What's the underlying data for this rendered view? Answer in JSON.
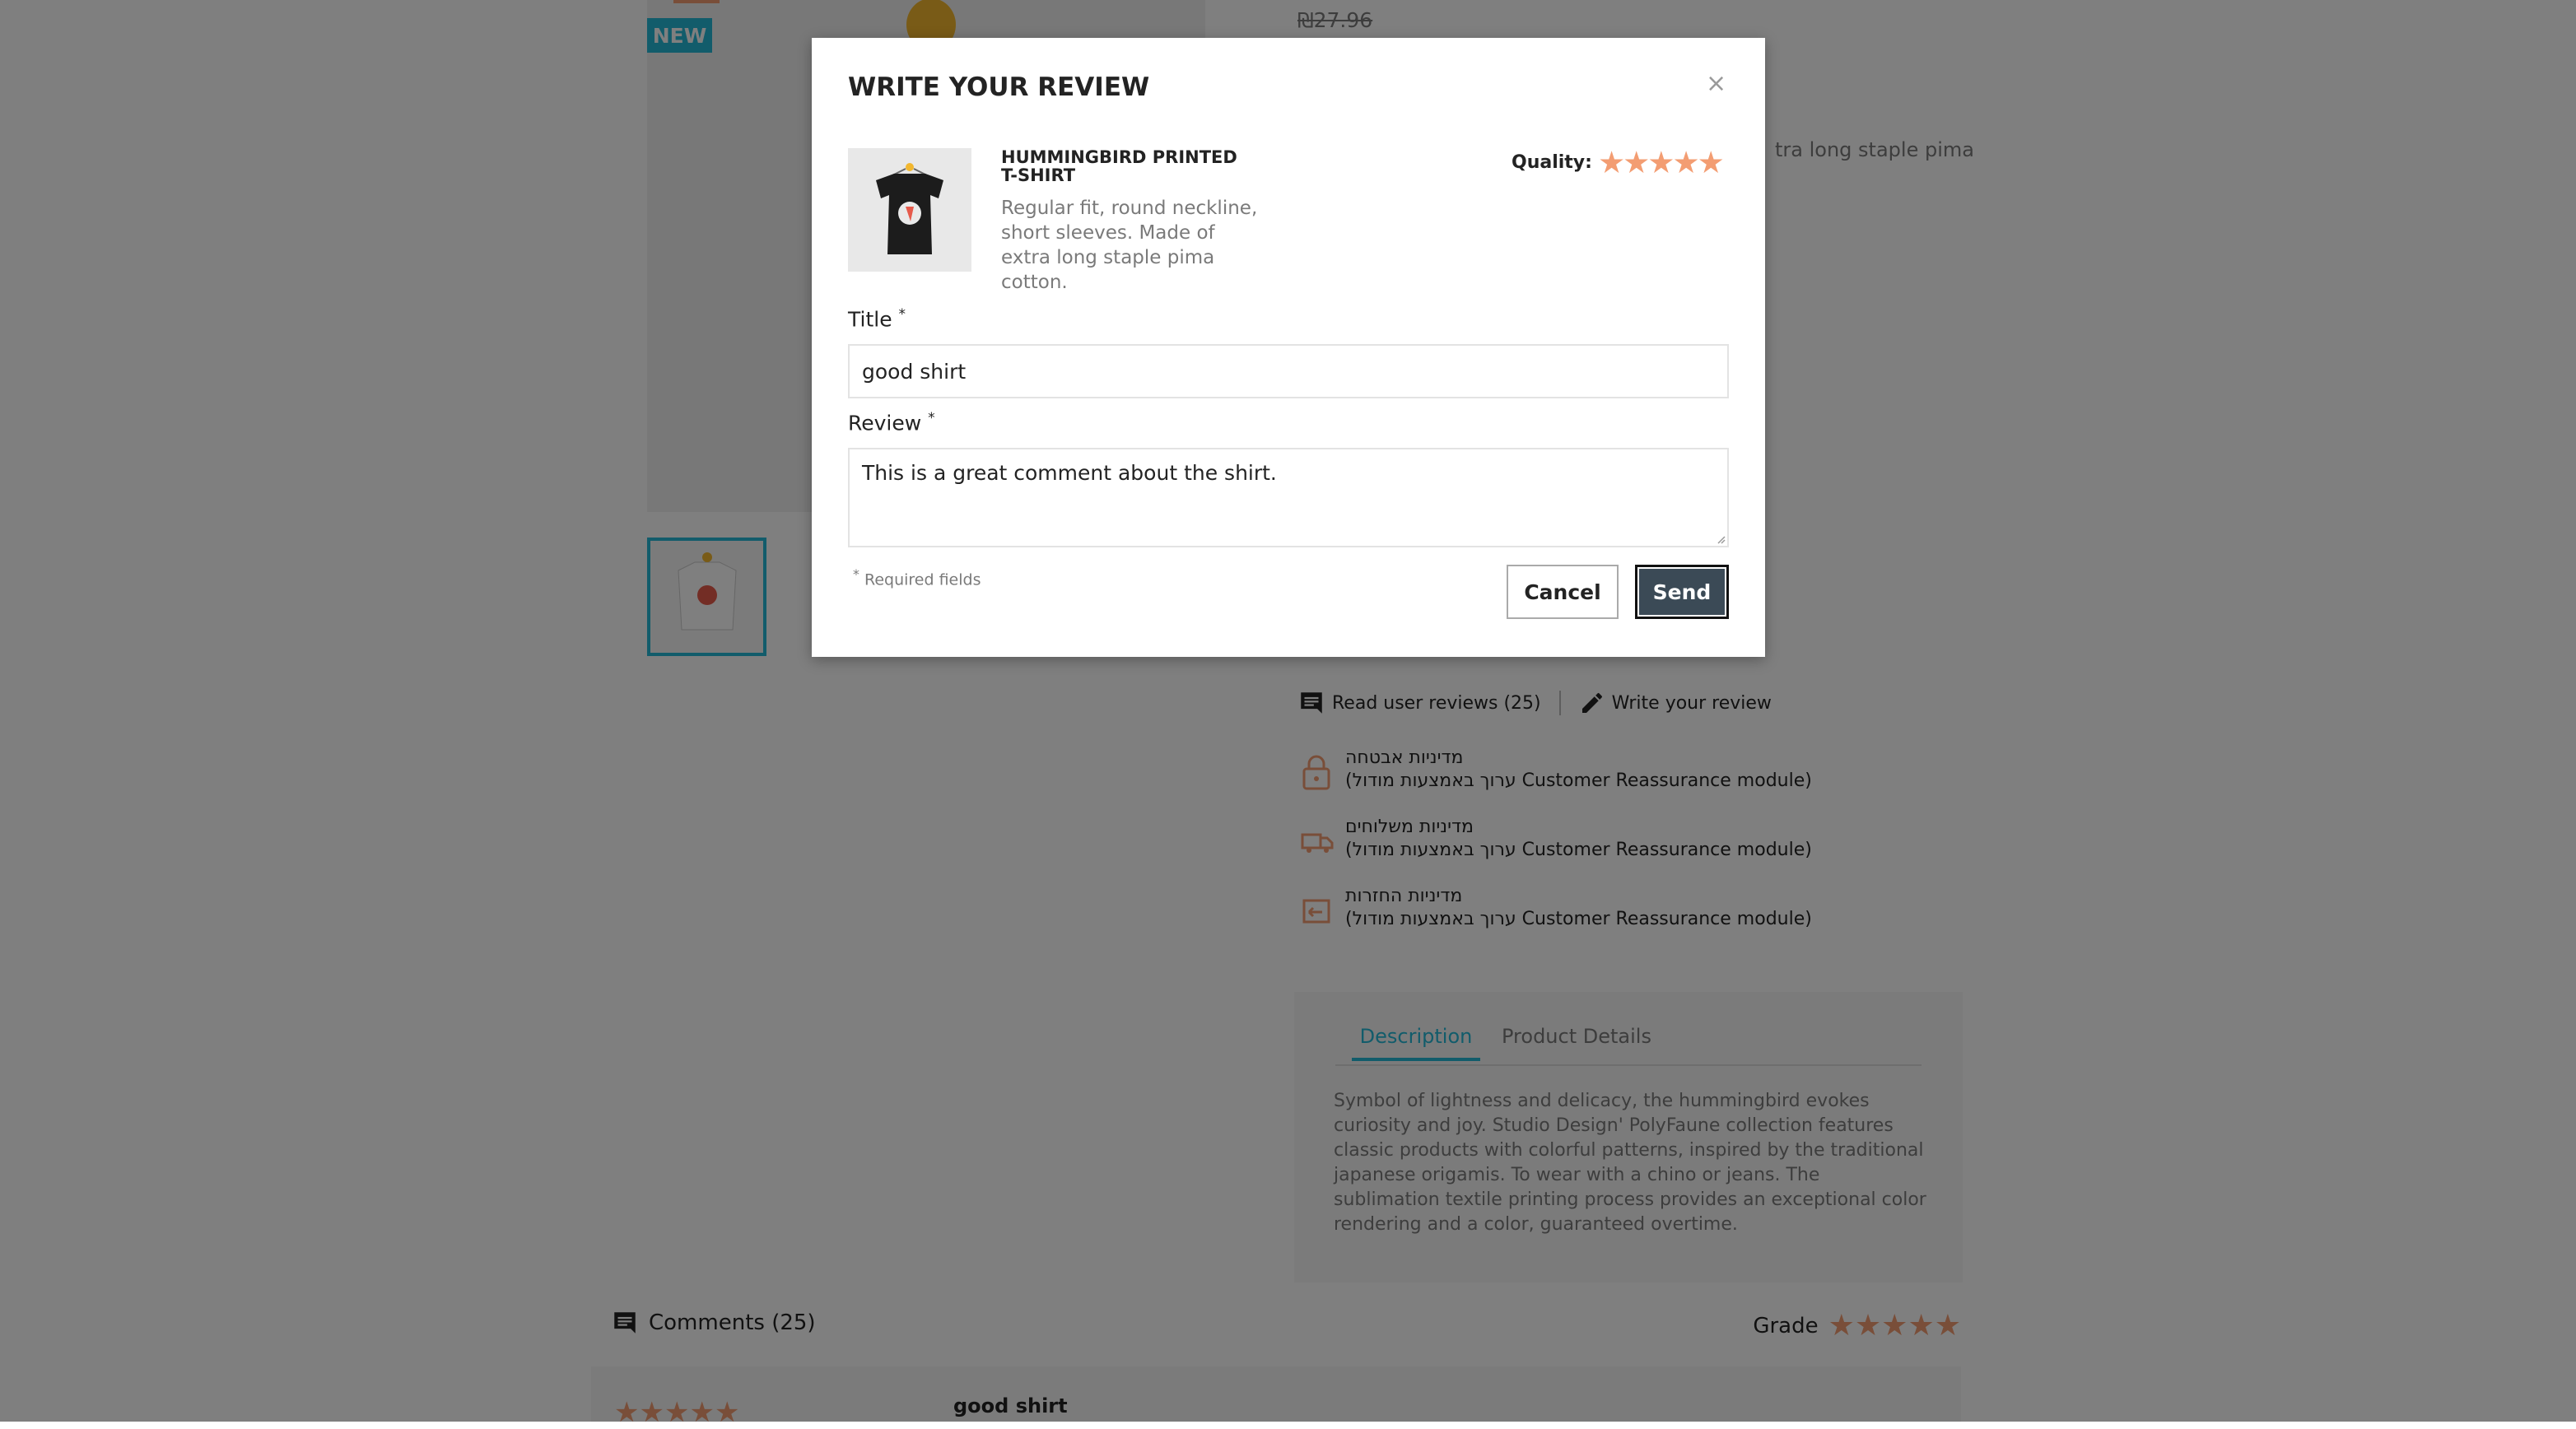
{
  "page": {
    "flag": "NEW",
    "price_old": "₪27.96",
    "desc_partial": "tra long staple pima",
    "links": {
      "read_reviews": "Read user reviews (25)",
      "write_review": "Write your review"
    },
    "reassurance": [
      {
        "line1": "מדיניות אבטחה",
        "line2": "(ערוך באמצעות מודול Customer Reassurance module)",
        "icon": "lock-icon"
      },
      {
        "line1": "מדיניות משלוחים",
        "line2": "(ערוך באמצעות מודול Customer Reassurance module)",
        "icon": "truck-icon"
      },
      {
        "line1": "מדיניות החזרות",
        "line2": "(ערוך באמצעות מודול Customer Reassurance module)",
        "icon": "return-icon"
      }
    ],
    "tabs": [
      {
        "label": "Description"
      },
      {
        "label": "Product Details"
      }
    ],
    "description": "Symbol of lightness and delicacy, the hummingbird evokes curiosity and joy. Studio Design' PolyFaune collection features classic products with colorful patterns, inspired by the traditional japanese origamis. To wear with a chino or jeans. The sublimation textile printing process provides an exceptional color rendering and a color, guaranteed overtime.",
    "comments_label": "Comments (25)",
    "grade_label": "Grade",
    "grade_stars": 5,
    "first_review_title": "good shirt"
  },
  "modal": {
    "title": "WRITE YOUR REVIEW",
    "close": "×",
    "product_name": "HUMMINGBIRD PRINTED T-SHIRT",
    "product_desc": "Regular fit, round neckline, short sleeves. Made of extra long staple pima cotton.",
    "quality_label": "Quality:",
    "quality_rating": 5,
    "title_label": "Title",
    "title_value": "good shirt",
    "review_label": "Review",
    "review_value": "This is a great comment about the shirt.",
    "required_marker": "*",
    "required_text": "Required fields",
    "cancel": "Cancel",
    "send": "Send"
  },
  "colors": {
    "accent": "#24b9d7",
    "star": "#f39d72",
    "send_button": "#3b4a56"
  }
}
